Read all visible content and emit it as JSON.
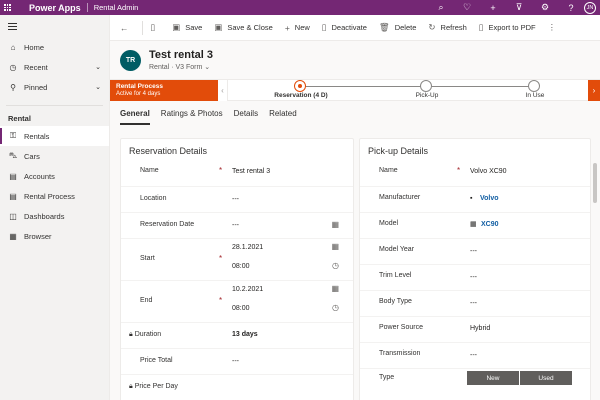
{
  "topbar": {
    "app_title": "Power Apps",
    "app_name": "Rental Admin",
    "user_initials": "JN",
    "icons": [
      "search-icon",
      "lightbulb-icon",
      "add-icon",
      "filter-icon",
      "settings-icon",
      "help-icon"
    ]
  },
  "sidebar": {
    "items": [
      {
        "label": "Home",
        "icon": "home-icon"
      },
      {
        "label": "Recent",
        "icon": "clock-icon"
      },
      {
        "label": "Pinned",
        "icon": "pin-icon"
      }
    ],
    "section": "Rental",
    "entities": [
      {
        "label": "Rentals",
        "icon": "key-icon",
        "active": true
      },
      {
        "label": "Cars",
        "icon": "car-icon"
      },
      {
        "label": "Accounts",
        "icon": "accounts-icon"
      },
      {
        "label": "Rental Process",
        "icon": "process-icon"
      },
      {
        "label": "Dashboards",
        "icon": "dashboard-icon"
      },
      {
        "label": "Browser",
        "icon": "browser-icon"
      }
    ]
  },
  "commandbar": {
    "save": "Save",
    "save_close": "Save & Close",
    "new": "New",
    "deactivate": "Deactivate",
    "delete": "Delete",
    "refresh": "Refresh",
    "export": "Export to PDF"
  },
  "record": {
    "initials": "TR",
    "title": "Test rental 3",
    "entity": "Rental",
    "form": "V3 Form"
  },
  "bpf": {
    "name": "Rental Process",
    "status": "Active for 4 days",
    "stages": [
      {
        "label": "Reservation  (4 D)",
        "active": true
      },
      {
        "label": "Pick-Up",
        "active": false
      },
      {
        "label": "In Use",
        "active": false
      }
    ]
  },
  "tabs": [
    "General",
    "Ratings & Photos",
    "Details",
    "Related"
  ],
  "reservation": {
    "title": "Reservation Details",
    "name_label": "Name",
    "name_value": "Test rental 3",
    "location_label": "Location",
    "location_value": "---",
    "resdate_label": "Reservation Date",
    "resdate_value": "---",
    "start_label": "Start",
    "start_date": "28.1.2021",
    "start_time": "08:00",
    "end_label": "End",
    "end_date": "10.2.2021",
    "end_time": "08:00",
    "duration_label": "Duration",
    "duration_value": "13 days",
    "pricetotal_label": "Price Total",
    "pricetotal_value": "---",
    "priceperday_label": "Price Per Day"
  },
  "pickup": {
    "title": "Pick-up Details",
    "name_label": "Name",
    "name_value": "Volvo XC90",
    "manufacturer_label": "Manufacturer",
    "manufacturer_value": "Volvo",
    "model_label": "Model",
    "model_value": "XC90",
    "modelyear_label": "Model Year",
    "modelyear_value": "---",
    "trim_label": "Trim Level",
    "trim_value": "---",
    "body_label": "Body Type",
    "body_value": "---",
    "power_label": "Power Source",
    "power_value": "Hybrid",
    "transmission_label": "Transmission",
    "transmission_value": "---",
    "type_label": "Type",
    "type_options": [
      "New",
      "Used"
    ]
  }
}
